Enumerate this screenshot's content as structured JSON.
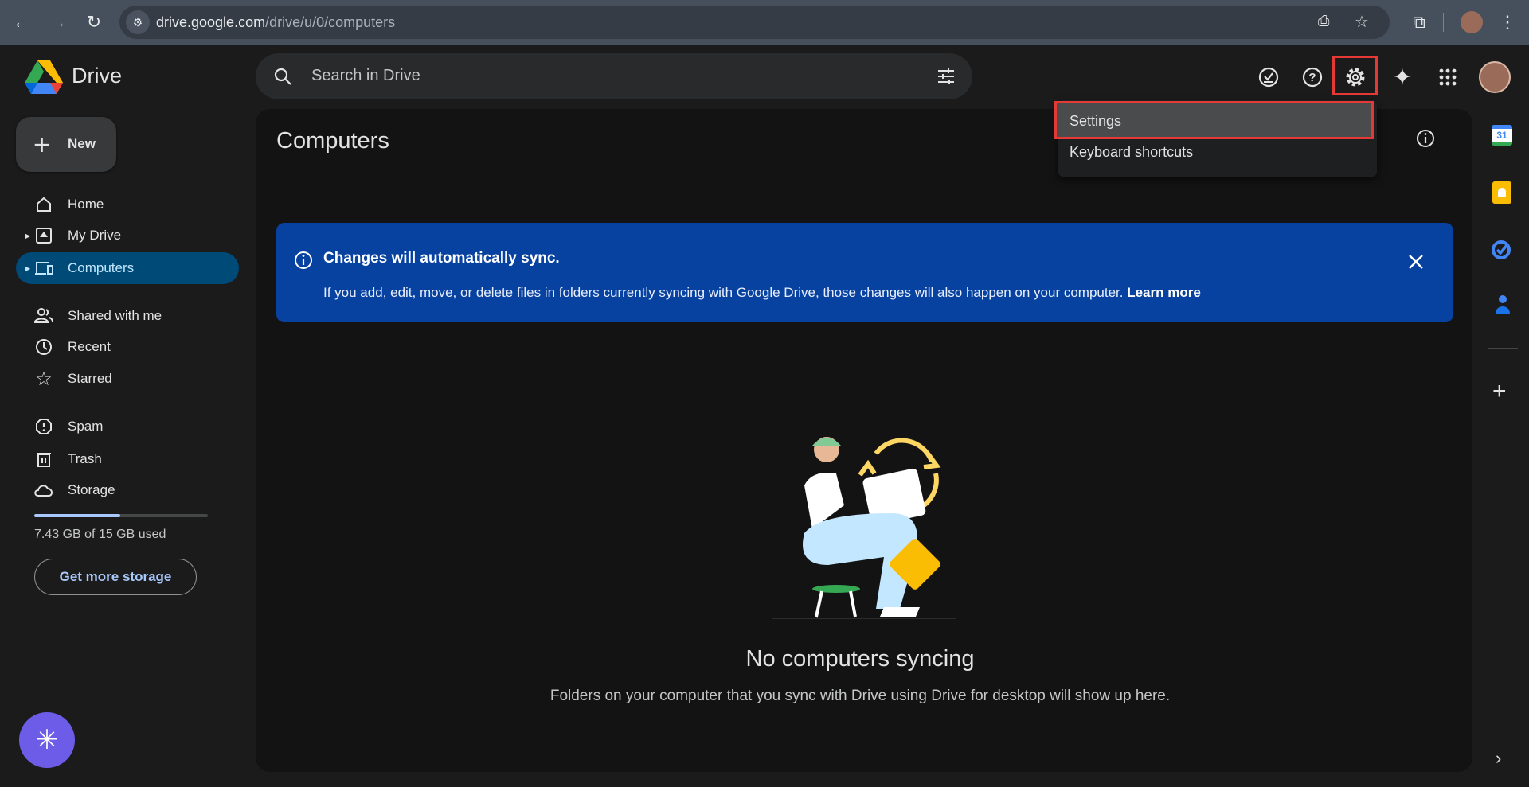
{
  "browser": {
    "url_host": "drive.google.com",
    "url_path": "/drive/u/0/computers"
  },
  "app": {
    "name": "Drive"
  },
  "search": {
    "placeholder": "Search in Drive"
  },
  "sidebar": {
    "new_label": "New",
    "items": [
      {
        "label": "Home",
        "icon": "home-icon"
      },
      {
        "label": "My Drive",
        "icon": "my-drive-icon"
      },
      {
        "label": "Computers",
        "icon": "computers-icon",
        "active": true
      },
      {
        "label": "Shared with me",
        "icon": "shared-icon"
      },
      {
        "label": "Recent",
        "icon": "clock-icon"
      },
      {
        "label": "Starred",
        "icon": "star-icon"
      },
      {
        "label": "Spam",
        "icon": "spam-icon"
      },
      {
        "label": "Trash",
        "icon": "trash-icon"
      },
      {
        "label": "Storage",
        "icon": "cloud-icon"
      }
    ],
    "storage": {
      "used_text": "7.43 GB of 15 GB used",
      "used_fraction": 0.495,
      "button": "Get more storage"
    }
  },
  "main": {
    "title": "Computers",
    "banner": {
      "heading": "Changes will automatically sync.",
      "body": "If you add, edit, move, or delete files in folders currently syncing with Google Drive, those changes will also happen on your computer.",
      "link": "Learn more"
    },
    "empty": {
      "heading": "No computers syncing",
      "subtext": "Folders on your computer that you sync with Drive using Drive for desktop will show up here."
    }
  },
  "settings_menu": {
    "items": [
      "Settings",
      "Keyboard shortcuts"
    ]
  },
  "colors": {
    "banner": "#0842a0",
    "active_nav": "#004a77",
    "highlight": "#e53935",
    "storage_fill": "#a8c7fa"
  }
}
